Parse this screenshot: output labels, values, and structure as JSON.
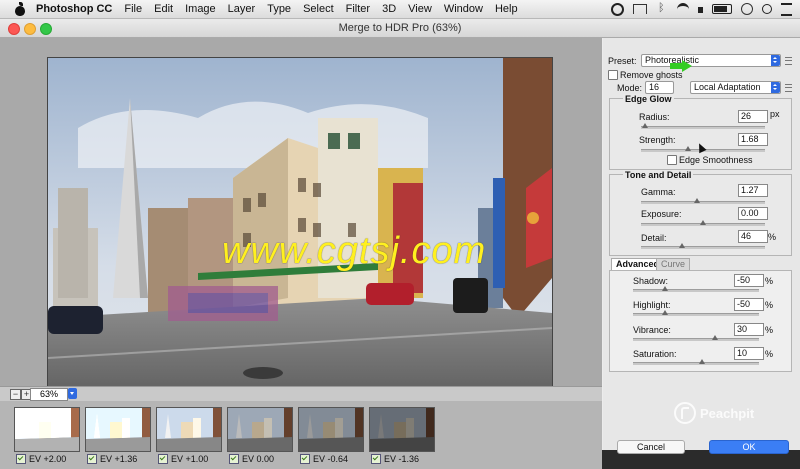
{
  "menubar": {
    "app_name": "Photoshop CC",
    "items": [
      "File",
      "Edit",
      "Image",
      "Layer",
      "Type",
      "Select",
      "Filter",
      "3D",
      "View",
      "Window",
      "Help"
    ],
    "tray_icons": [
      "creative-cloud-icon",
      "airplay-icon",
      "bluetooth-icon",
      "wifi-icon",
      "volume-icon",
      "battery-icon",
      "user-icon",
      "spotlight-search-icon",
      "notification-list-icon"
    ]
  },
  "dialog": {
    "title": "Merge to HDR Pro (63%)",
    "zoom": "63%",
    "watermark": "www.cgtsj.com",
    "thumbnails": [
      {
        "label": "EV +2.00",
        "brightness": 1.45
      },
      {
        "label": "EV +1.36",
        "brightness": 1.25
      },
      {
        "label": "EV +1.00",
        "brightness": 1.1
      },
      {
        "label": "EV 0.00",
        "brightness": 0.85
      },
      {
        "label": "EV -0.64",
        "brightness": 0.7
      },
      {
        "label": "EV -1.36",
        "brightness": 0.55
      }
    ]
  },
  "panel": {
    "preset_label": "Preset:",
    "preset_value": "Photorealistic",
    "remove_ghosts": "Remove ghosts",
    "mode_label": "Mode:",
    "bit_depth": "16",
    "method": "Local Adaptation",
    "edge_glow": {
      "title": "Edge Glow",
      "radius_label": "Radius:",
      "radius": "26",
      "radius_unit": "px",
      "radius_pos": 0.03,
      "strength_label": "Strength:",
      "strength": "1.68",
      "strength_pos": 0.38,
      "edge_smoothness": "Edge Smoothness"
    },
    "tone_detail": {
      "title": "Tone and Detail",
      "gamma_label": "Gamma:",
      "gamma": "1.27",
      "gamma_pos": 0.45,
      "exposure_label": "Exposure:",
      "exposure": "0.00",
      "exposure_pos": 0.5,
      "detail_label": "Detail:",
      "detail": "46",
      "detail_unit": "%",
      "detail_pos": 0.33
    },
    "tabs": [
      "Advanced",
      "Curve"
    ],
    "advanced": {
      "shadow_label": "Shadow:",
      "shadow": "-50",
      "shadow_pos": 0.25,
      "highlight_label": "Highlight:",
      "highlight": "-50",
      "highlight_pos": 0.25,
      "vibrance_label": "Vibrance:",
      "vibrance": "30",
      "vibrance_pos": 0.65,
      "saturation_label": "Saturation:",
      "saturation": "10",
      "saturation_pos": 0.55,
      "unit": "%"
    },
    "cancel": "Cancel",
    "ok": "OK"
  },
  "branding": "Peachpit",
  "colors": {
    "accent": "#2f6ae0",
    "watermark": "#fff01f",
    "arrow": "#33cc22"
  }
}
